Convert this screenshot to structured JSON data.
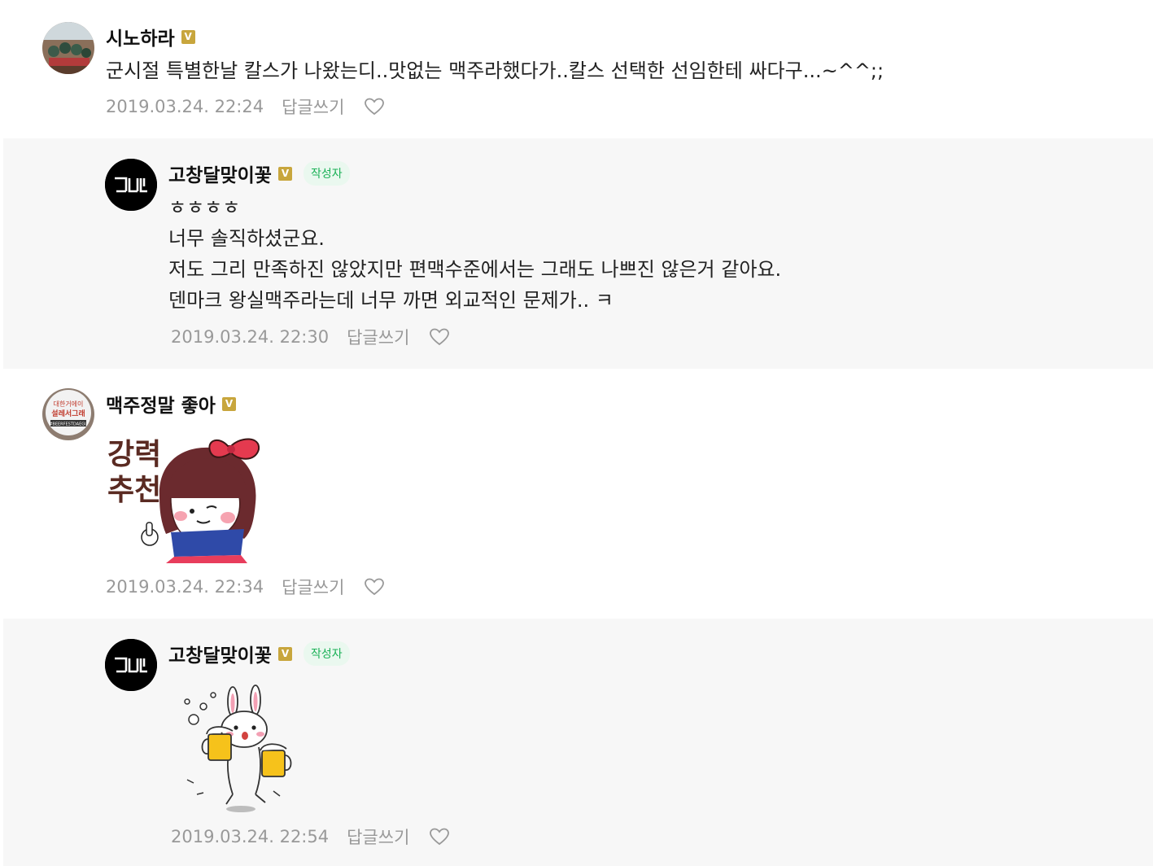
{
  "comments": [
    {
      "author": "시노하라",
      "badge": "V",
      "text": "군시절 특별한날 칼스가 나왔는디..맛없는 맥주라했다가..칼스 선택한 선임한테 싸다구...~^^;;",
      "date": "2019.03.24. 22:24",
      "reply_label": "답글쓰기"
    },
    {
      "author": "고창달맞이꽃",
      "badge": "V",
      "author_tag": "작성자",
      "lines": [
        "ㅎㅎㅎㅎ",
        "너무 솔직하셨군요.",
        "저도 그리 만족하진 않았지만 편맥수준에서는 그래도 나쁘진 않은거 같아요.",
        "덴마크 왕실맥주라는데 너무 까면 외교적인 문제가.. ㅋ"
      ],
      "date": "2019.03.24. 22:30",
      "reply_label": "답글쓰기"
    },
    {
      "author": "맥주정말 좋아",
      "badge": "V",
      "avatar_text": "대한거에이 설레서그래 #BEERFESTDAEGU",
      "sticker_text": [
        "강력",
        "추천"
      ],
      "date": "2019.03.24. 22:34",
      "reply_label": "답글쓰기"
    },
    {
      "author": "고창달맞이꽃",
      "badge": "V",
      "author_tag": "작성자",
      "date": "2019.03.24. 22:54",
      "reply_label": "답글쓰기"
    }
  ],
  "colors": {
    "badge": "#c8a63d",
    "author_tag_text": "#1bb157",
    "author_tag_bg": "#eaf8ef",
    "reply_bg": "#f7f7f7",
    "meta": "#999999"
  },
  "icons": [
    "verified-badge-icon",
    "heart-icon",
    "avatar-logo-gdl"
  ]
}
